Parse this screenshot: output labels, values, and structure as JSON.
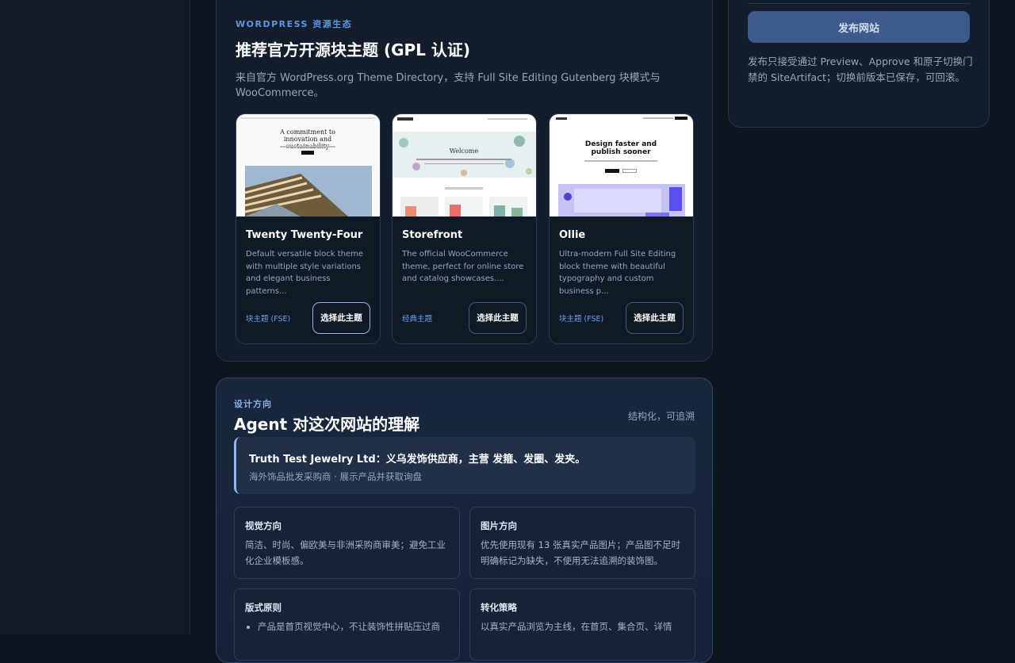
{
  "themes_section": {
    "eyebrow": "WORDPRESS 资源生态",
    "title": "推荐官方开源块主题 (GPL 认证)",
    "description": "来自官方 WordPress.org Theme Directory，支持 Full Site Editing Gutenberg 块模式与 WooCommerce。",
    "themes": [
      {
        "name": "Twenty Twenty-Four",
        "description": "Default versatile block theme with multiple style variations and elegant business patterns...",
        "tag": "块主题 (FSE)",
        "button": "选择此主题",
        "thumb_headline": "A commitment to innovation and sustainability"
      },
      {
        "name": "Storefront",
        "description": "The official WooCommerce theme, perfect for online store and catalog showcases....",
        "tag": "经典主题",
        "button": "选择此主题",
        "thumb_headline": "Welcome"
      },
      {
        "name": "Ollie",
        "description": "Ultra-modern Full Site Editing block theme with beautiful typography and custom business p...",
        "tag": "块主题 (FSE)",
        "button": "选择此主题",
        "thumb_headline": "Design faster and publish sooner"
      }
    ]
  },
  "publish": {
    "button": "发布网站",
    "note": "发布只接受通过 Preview、Approve 和原子切换门禁的 SiteArtifact；切换前版本已保存，可回滚。"
  },
  "agent": {
    "eyebrow": "设计方向",
    "title": "Agent 对这次网站的理解",
    "meta": "结构化，可追溯",
    "summary_title": "Truth Test Jewelry Ltd：义乌发饰供应商，主营 发箍、发圈、发夹。",
    "summary_sub": "海外饰品批发采购商 · 展示产品并获取询盘",
    "cards": [
      {
        "title": "视觉方向",
        "body": "简洁、时尚、偏欧美与非洲采购商审美；避免工业化企业模板感。"
      },
      {
        "title": "图片方向",
        "body": "优先使用现有 13 张真实产品图片；产品图不足时明确标记为缺失，不使用无法追溯的装饰图。"
      },
      {
        "title": "版式原则",
        "items": [
          "产品是首页视觉中心，不让装饰性拼贴压过商"
        ]
      },
      {
        "title": "转化策略",
        "body": "以真实产品浏览为主线，在首页、集合页、详情"
      }
    ]
  }
}
